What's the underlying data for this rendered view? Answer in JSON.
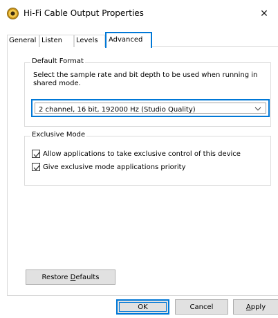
{
  "window": {
    "title": "Hi-Fi Cable Output Properties",
    "close_glyph": "✕",
    "app_icon": "speaker-icon"
  },
  "tabs": [
    {
      "label": "General",
      "active": false
    },
    {
      "label": "Listen",
      "active": false
    },
    {
      "label": "Levels",
      "active": false
    },
    {
      "label": "Advanced",
      "active": true
    }
  ],
  "default_format": {
    "legend": "Default Format",
    "description": "Select the sample rate and bit depth to be used when running in shared mode.",
    "selected_format": "2 channel, 16 bit, 192000 Hz (Studio Quality)"
  },
  "exclusive_mode": {
    "legend": "Exclusive Mode",
    "options": [
      {
        "label": "Allow applications to take exclusive control of this device",
        "checked": true
      },
      {
        "label": "Give exclusive mode applications priority",
        "checked": true
      }
    ]
  },
  "buttons": {
    "restore_prefix": "Restore ",
    "restore_access": "D",
    "restore_suffix": "efaults",
    "ok": "OK",
    "cancel": "Cancel",
    "apply_access": "A",
    "apply_suffix": "pply"
  },
  "colors": {
    "accent": "#0078d7",
    "button_face": "#e1e1e1",
    "border": "#adadad"
  }
}
